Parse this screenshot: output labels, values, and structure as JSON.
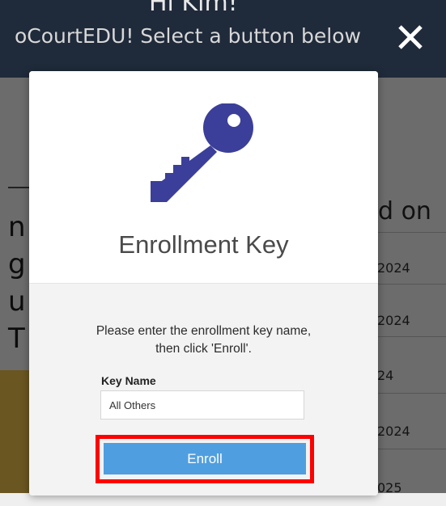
{
  "background": {
    "greeting": "Hi Kim!",
    "welcome": "oCourtEDU!  Select a button below",
    "left_fragments": [
      "n",
      "g",
      "u",
      "T"
    ],
    "right_header": "d on",
    "right_dates": [
      "2024",
      "2024",
      "24",
      "2024",
      "025"
    ]
  },
  "modal": {
    "title": "Enrollment Key",
    "instructions_line1": "Please enter the enrollment key name,",
    "instructions_line2": "then click 'Enroll'.",
    "key_label": "Key Name",
    "key_value": "All Others",
    "enroll_label": "Enroll"
  },
  "colors": {
    "key_icon": "#3b3f99",
    "enroll_button": "#4f9fe0",
    "highlight": "#ff0000"
  },
  "icons": {
    "close": "close-icon",
    "key": "key-icon"
  }
}
